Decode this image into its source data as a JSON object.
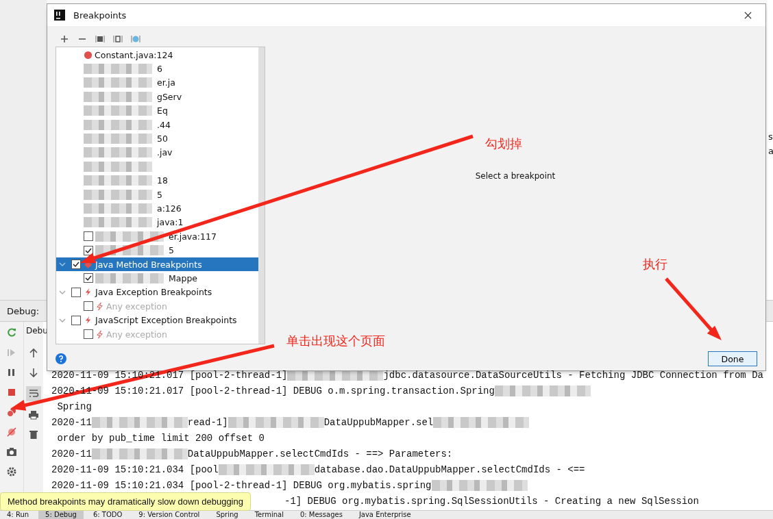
{
  "dialog": {
    "title": "Breakpoints",
    "hint": "Select a breakpoint",
    "done_button": "Done",
    "breakpoints": [
      {
        "text": "Constant.java:124",
        "blurred": false
      },
      {
        "text": "6",
        "blurred": true
      },
      {
        "text": "er.ja",
        "blurred": true
      },
      {
        "text": "gServ",
        "blurred": true
      },
      {
        "text": "Eq",
        "blurred": true
      },
      {
        "text": ".44",
        "blurred": true
      },
      {
        "text": "50",
        "blurred": true
      },
      {
        "text": ".jav",
        "blurred": true
      },
      {
        "blurred": true
      },
      {
        "text": "18",
        "blurred": true
      },
      {
        "text": "5",
        "blurred": true
      },
      {
        "text": "a:126",
        "blurred": true
      },
      {
        "text": "java:1",
        "blurred": true
      },
      {
        "text": "er.java:117",
        "blurred": true,
        "checked": false
      },
      {
        "text": "5",
        "blurred": true,
        "checked": true
      }
    ],
    "groups": [
      {
        "kind": "method",
        "label": "Java Method Breakpoints",
        "selected": true,
        "checked": true,
        "expanded": true,
        "children": [
          {
            "text": "Mappe",
            "blurred": true,
            "checked": true,
            "disabled": false
          }
        ]
      },
      {
        "kind": "exception",
        "label": "Java Exception Breakpoints",
        "selected": false,
        "checked": false,
        "expanded": true,
        "children": [
          {
            "text": "Any exception",
            "blurred": false,
            "checked": false,
            "disabled": true
          }
        ]
      },
      {
        "kind": "exception",
        "label": "JavaScript Exception Breakpoints",
        "selected": false,
        "checked": false,
        "expanded": true,
        "children": [
          {
            "text": "Any exception",
            "blurred": false,
            "checked": false,
            "disabled": true
          }
        ]
      }
    ]
  },
  "edge_fragments": [
    "s",
    "a"
  ],
  "debug": {
    "label": "Debug:",
    "tab": "Debu",
    "log": [
      [
        {
          "text": "2020-11-09 15:10:21.017 [pool-2-thread-1]"
        },
        {
          "kind": "blur"
        },
        {
          "text": "jdbc.datasource.DataSourceUtils - Fetching JDBC Connection from Da"
        }
      ],
      [
        {
          "text": "2020-11-09 15:10:21.017 [pool-2-thread-1] DEBUG o.m.spring.transaction.Spring"
        },
        {
          "kind": "blur"
        }
      ],
      [
        {
          "text": " Spring"
        }
      ],
      [
        {
          "text": "2020-11"
        },
        {
          "kind": "blur"
        },
        {
          "text": "read-1]"
        },
        {
          "kind": "blur"
        },
        {
          "text": "DataUppubMapper.sel"
        },
        {
          "kind": "blur"
        }
      ],
      [
        {
          "text": " order by pub_time limit 200 offset 0"
        }
      ],
      [
        {
          "text": "2020-11"
        },
        {
          "kind": "blur"
        },
        {
          "text": "DataUppubMapper.selectCmdIds - ==> Parameters:"
        }
      ],
      [
        {
          "text": "2020-11-09 15:10:21.034 [pool"
        },
        {
          "kind": "blur"
        },
        {
          "text": "database.dao.DataUppubMapper.selectCmdIds - <=="
        }
      ],
      [
        {
          "text": "2020-11-09 15:10:21.034 [pool-2-thread-1] DEBUG org.mybatis.spring"
        },
        {
          "kind": "blur"
        }
      ],
      [
        {
          "kind": "covered"
        },
        {
          "text": "-1] DEBUG org.mybatis.spring.SqlSessionUtils - Creating a new SqlSession"
        }
      ]
    ]
  },
  "tooltip": "Method breakpoints may dramatically slow down debugging",
  "bottom_tabs": [
    {
      "label": "4: Run",
      "selected": false
    },
    {
      "label": "5: Debug",
      "selected": true
    },
    {
      "label": "6: TODO",
      "selected": false
    },
    {
      "label": "9: Version Control",
      "selected": false
    },
    {
      "label": "Spring",
      "selected": false
    },
    {
      "label": "Terminal",
      "selected": false
    },
    {
      "label": "0: Messages",
      "selected": false
    },
    {
      "label": "Java Enterprise",
      "selected": false
    }
  ],
  "annotations": [
    "勾划掉",
    "执行",
    "单击出现这个页面"
  ]
}
